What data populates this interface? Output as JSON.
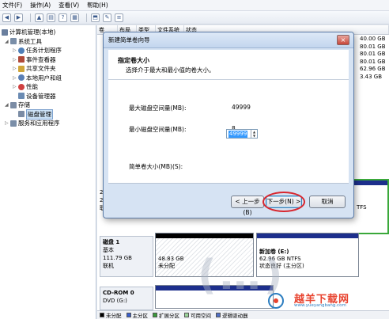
{
  "menubar": [
    "文件(F)",
    "操作(A)",
    "查看(V)",
    "帮助(H)"
  ],
  "tree": [
    {
      "label": "计算机管理(本地)",
      "indent": 0,
      "color": "#6a7f9e"
    },
    {
      "label": "系统工具",
      "indent": 1,
      "color": "#7a8ea8"
    },
    {
      "label": "任务计划程序",
      "indent": 2,
      "color": "#4f7fb8"
    },
    {
      "label": "事件查看器",
      "indent": 2,
      "color": "#b04a3a"
    },
    {
      "label": "共享文件夹",
      "indent": 2,
      "color": "#d0a63a"
    },
    {
      "label": "本地用户和组",
      "indent": 2,
      "color": "#5a7fb5"
    },
    {
      "label": "性能",
      "indent": 2,
      "color": "#d04040"
    },
    {
      "label": "设备管理器",
      "indent": 2,
      "color": "#6b8bb3"
    },
    {
      "label": "存储",
      "indent": 1,
      "color": "#7b8ca5"
    },
    {
      "label": "磁盘管理",
      "indent": 2,
      "color": "#7b8ca5",
      "selected": true
    },
    {
      "label": "服务和应用程序",
      "indent": 1,
      "color": "#7a8ea8"
    }
  ],
  "columns": [
    "卷",
    "布局",
    "类型",
    "文件系统",
    "状态"
  ],
  "volume_sizes": [
    "40.00 GB",
    "80.01 GB",
    "80.01 GB",
    "80.01 GB",
    "62.96 GB",
    "3.43 GB"
  ],
  "dialog": {
    "title": "新建简单卷向导",
    "close": "×",
    "heading": "指定卷大小",
    "subheading": "选择介于最大和最小值的卷大小。",
    "max_label": "最大磁盘空间量(MB):",
    "max_value": "49999",
    "min_label": "最小磁盘空间量(MB):",
    "min_value": "8",
    "size_label": "简单卷大小(MB)(S):",
    "size_value": "49999",
    "back": "< 上一步(B)",
    "next": "下一步(N) >",
    "cancel": "取消"
  },
  "disk1": {
    "name": "磁盘 1",
    "type": "基本",
    "size": "111.79 GB",
    "status": "联机",
    "unalloc_size": "48.83 GB",
    "unalloc_label": "未分配",
    "vol_name": "新加卷 (E:)",
    "vol_size": "62.96 GB NTFS",
    "vol_status": "状态良好 (主分区)"
  },
  "cdrom": {
    "name": "CD-ROM 0",
    "drive": "DVD (G:)"
  },
  "disk0_fragments": [
    "2",
    "2",
    "联"
  ],
  "ntfs_fragment": "TFS",
  "legend": [
    {
      "label": "未分配",
      "color": "#000000"
    },
    {
      "label": "主分区",
      "color": "#3a5fcf"
    },
    {
      "label": "扩展分区",
      "color": "#3a9b3a"
    },
    {
      "label": "可用空间",
      "color": "#9ad39a"
    },
    {
      "label": "逻辑驱动器",
      "color": "#4f6fc8"
    }
  ],
  "watermark": {
    "title": "越羊下载网",
    "url": "www.yueyangbang.com"
  }
}
